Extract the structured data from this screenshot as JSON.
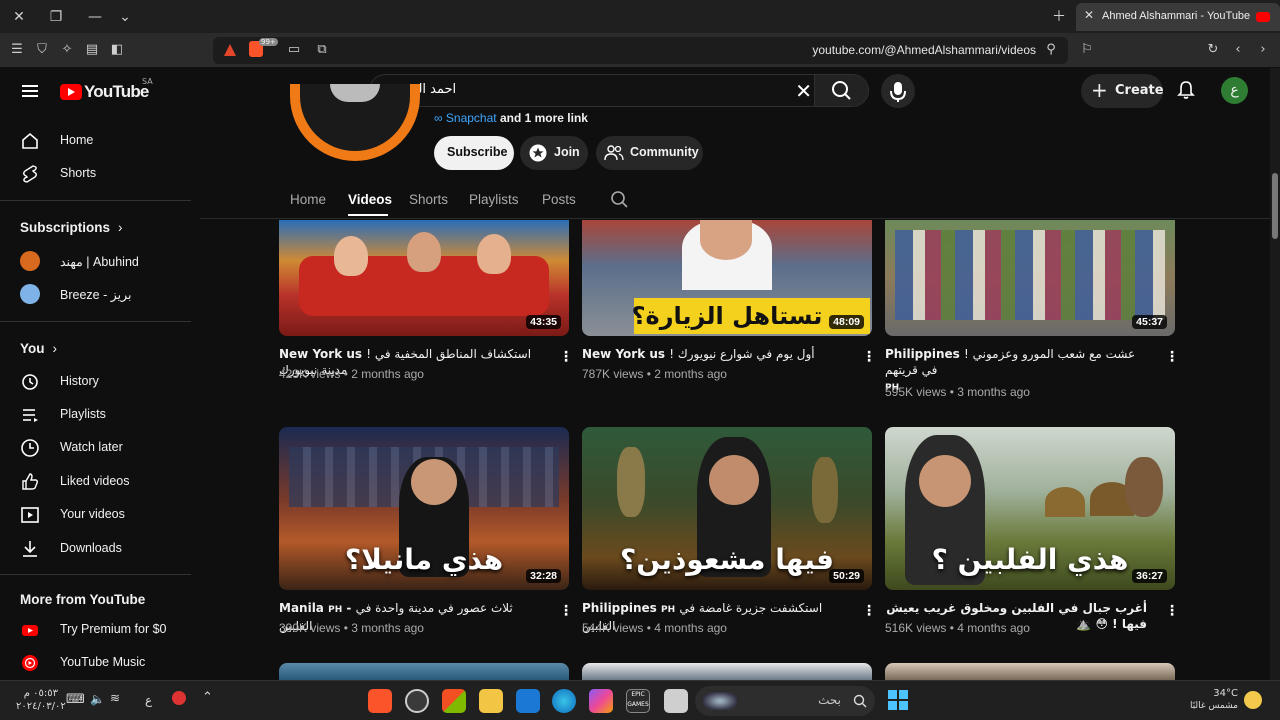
{
  "browser": {
    "tab_title": "Ahmed Alshammari - YouTube",
    "url": "youtube.com/@AhmedAlshammari/videos",
    "brave_badge": "99+"
  },
  "header": {
    "logo_text": "YouTube",
    "country_code": "SA",
    "search_query": "احمد الشمري",
    "create_label": "Create",
    "avatar_letter": "ع"
  },
  "sidebar": {
    "main": [
      {
        "label": "Home",
        "icon": "home-icon"
      },
      {
        "label": "Shorts",
        "icon": "shorts-icon"
      }
    ],
    "subscriptions_title": "Subscriptions",
    "subscriptions": [
      {
        "label": "مهند | Abuhind",
        "color": "#d86a1f"
      },
      {
        "label": "Breeze - بريز",
        "color": "#7fb3e8"
      }
    ],
    "you_title": "You",
    "you": [
      {
        "label": "History",
        "icon": "history-icon"
      },
      {
        "label": "Playlists",
        "icon": "playlists-icon"
      },
      {
        "label": "Watch later",
        "icon": "watch-later-icon"
      },
      {
        "label": "Liked videos",
        "icon": "liked-videos-icon"
      },
      {
        "label": "Your videos",
        "icon": "your-videos-icon"
      },
      {
        "label": "Downloads",
        "icon": "downloads-icon"
      }
    ],
    "more_title": "More from YouTube",
    "more": [
      {
        "label": "Try Premium for $0",
        "icon": "youtube-premium-icon"
      },
      {
        "label": "YouTube Music",
        "icon": "youtube-music-icon"
      }
    ]
  },
  "channel": {
    "link_text": "Snapchat",
    "more_links": "and 1 more link",
    "subscribe_label": "Subscribe",
    "join_label": "Join",
    "community_label": "Community",
    "tabs": [
      "Home",
      "Videos",
      "Shorts",
      "Playlists",
      "Posts"
    ],
    "active_tab": "Videos"
  },
  "videos": [
    {
      "title_tag": "New York us",
      "title": "! استكشاف المناطق المخفية في مدينة نيويورك",
      "views": "423K views",
      "age": "2 months ago",
      "duration": "43:35",
      "overlay": ""
    },
    {
      "title_tag": "New York us",
      "title": "! أول يوم في شوارع نيويورك",
      "views": "787K views",
      "age": "2 months ago",
      "duration": "48:09",
      "overlay": "تستاهل الزيارة؟"
    },
    {
      "title_tag": "Philippines",
      "title": "! عشت مع شعب المورو وعزموني في قريتهم",
      "sub": "PH",
      "views": "595K views",
      "age": "3 months ago",
      "duration": "45:37",
      "overlay": ""
    },
    {
      "title_tag": "Manila",
      "tag_sub": "PH",
      "title": "ثلاث عصور في مدينة واحدة في الفلبين",
      "views": "390K views",
      "age": "3 months ago",
      "duration": "32:28",
      "overlay": "هذي مانيلا؟"
    },
    {
      "title_tag": "Philippines",
      "tag_sub": "PH",
      "title": "استكشفت جزيرة غامضة في الفلبين",
      "views": "544K views",
      "age": "4 months ago",
      "duration": "50:29",
      "overlay": "فيها مشعوذين؟"
    },
    {
      "title_tag": "",
      "title": "أغرب جبال في الفلبين ومخلوق غريب يعيش فيها ! 😳 ⛰️",
      "views": "516K views",
      "age": "4 months ago",
      "duration": "36:27",
      "overlay": "هذي الفلبين ؟"
    }
  ],
  "taskbar": {
    "search_placeholder": "بحث",
    "weather_temp": "34°C",
    "weather_desc": "مشمس غالبًا",
    "time": "٠٥:٥٣ م",
    "date": "٢٠٢٤/٠٣/٠٢",
    "lang": "ع"
  }
}
